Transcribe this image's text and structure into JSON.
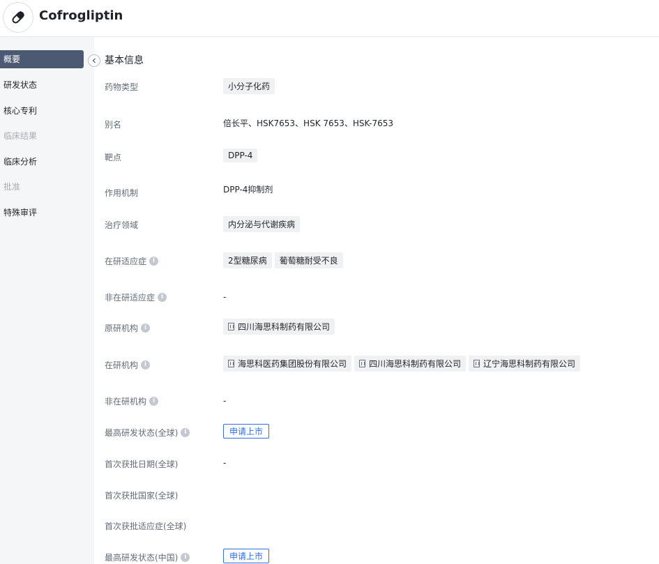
{
  "header": {
    "title": "Cofrogliptin",
    "logo_icon": "pill-icon"
  },
  "sidebar": {
    "items": [
      {
        "label": "概要",
        "state": "active"
      },
      {
        "label": "研发状态",
        "state": "normal"
      },
      {
        "label": "核心专利",
        "state": "normal"
      },
      {
        "label": "临床结果",
        "state": "disabled"
      },
      {
        "label": "临床分析",
        "state": "normal"
      },
      {
        "label": "批准",
        "state": "disabled"
      },
      {
        "label": "特殊审评",
        "state": "normal"
      }
    ]
  },
  "section": {
    "title": "基本信息"
  },
  "fields": {
    "drug_type": {
      "label": "药物类型",
      "tags": [
        "小分子化药"
      ]
    },
    "alias": {
      "label": "别名",
      "value": "倍长平、HSK7653、HSK 7653、HSK-7653"
    },
    "target": {
      "label": "靶点",
      "tags": [
        "DPP-4"
      ]
    },
    "mechanism": {
      "label": "作用机制",
      "value": "DPP-4抑制剂"
    },
    "therapeutic_area": {
      "label": "治疗领域",
      "tags": [
        "内分泌与代谢疾病"
      ]
    },
    "active_indication": {
      "label": "在研适应症",
      "tags": [
        "2型糖尿病",
        "葡萄糖耐受不良"
      ]
    },
    "inactive_indication": {
      "label": "非在研适应症",
      "value": "-"
    },
    "originator": {
      "label": "原研机构",
      "orgs": [
        "四川海思科制药有限公司"
      ]
    },
    "active_org": {
      "label": "在研机构",
      "orgs": [
        "海思科医药集团股份有限公司",
        "四川海思科制药有限公司",
        "辽宁海思科制药有限公司"
      ]
    },
    "inactive_org": {
      "label": "非在研机构",
      "value": "-"
    },
    "highest_status_global": {
      "label": "最高研发状态(全球)",
      "status": "申请上市"
    },
    "first_approval_date_global": {
      "label": "首次获批日期(全球)",
      "value": "-"
    },
    "first_approval_country_global": {
      "label": "首次获批国家(全球)",
      "value": ""
    },
    "first_approval_indication_global": {
      "label": "首次获批适应症(全球)",
      "value": ""
    },
    "highest_status_china": {
      "label": "最高研发状态(中国)",
      "status": "申请上市"
    }
  },
  "colors": {
    "accent": "#2f6fe0",
    "sidebar_active": "#4b5a72",
    "tag_bg": "#f0f1f3"
  }
}
